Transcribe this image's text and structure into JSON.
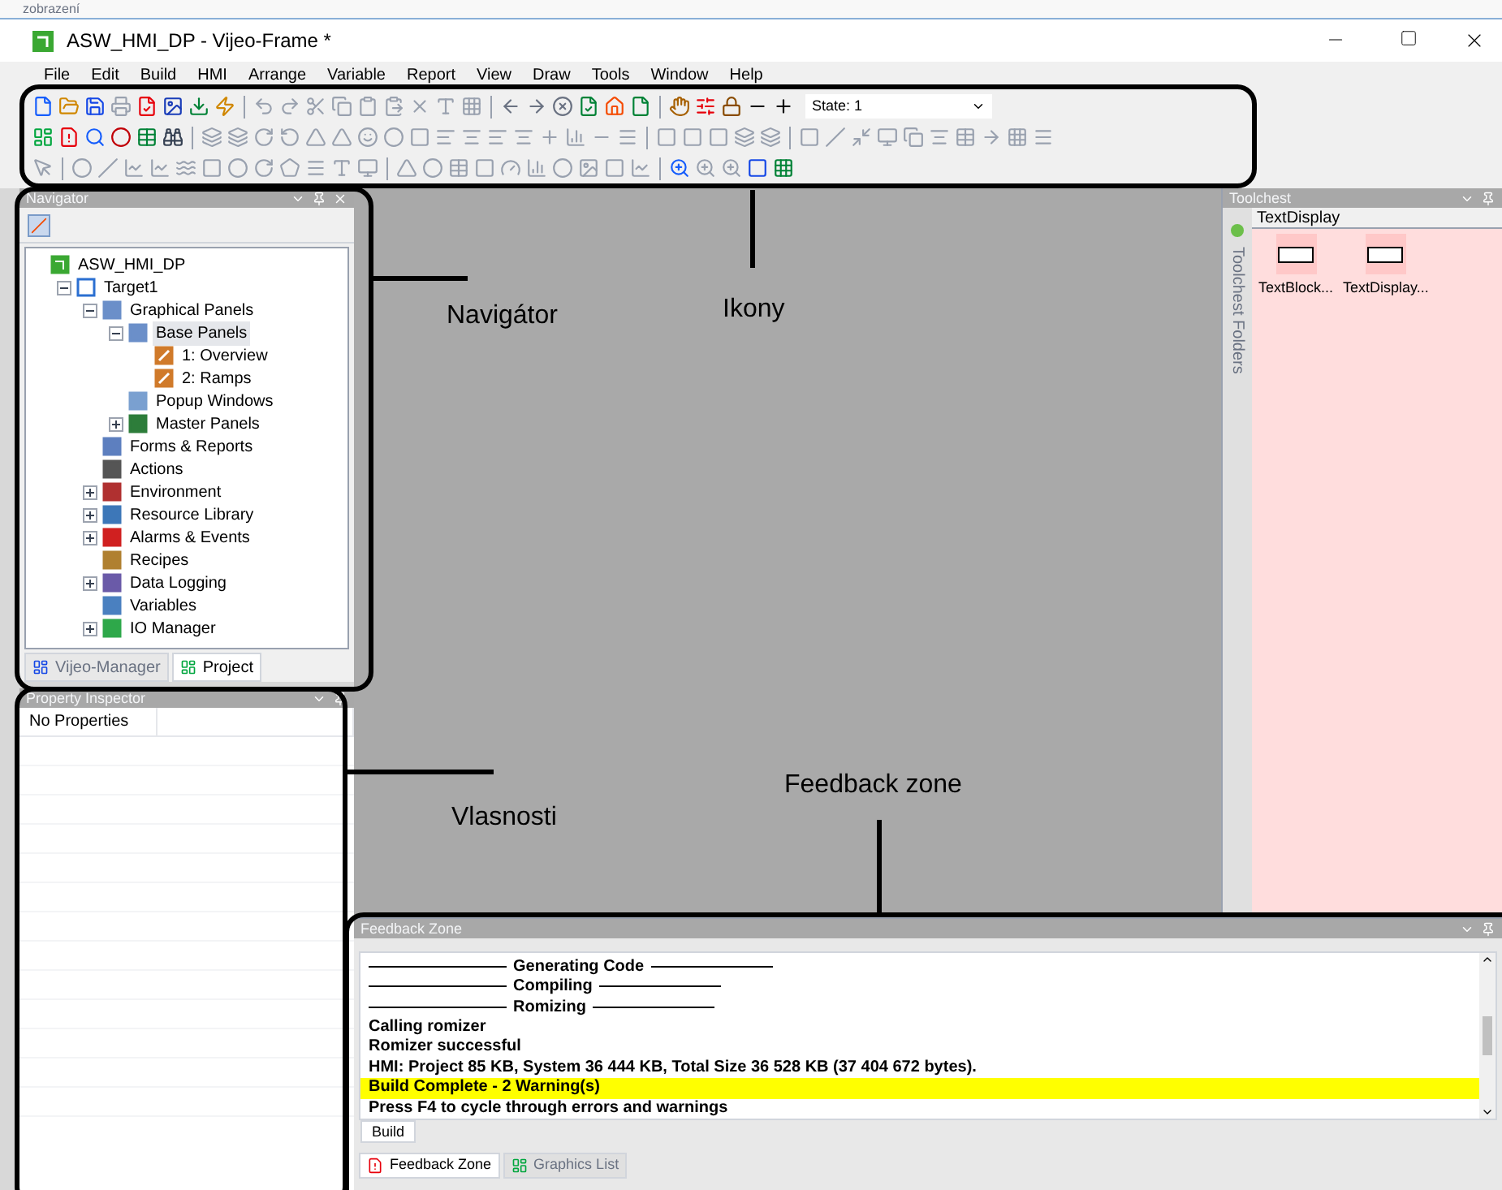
{
  "top_fragment": "zobrazení",
  "window": {
    "title": "ASW_HMI_DP - Vijeo-Frame *"
  },
  "menu": [
    "File",
    "Edit",
    "Build",
    "HMI",
    "Arrange",
    "Variable",
    "Report",
    "View",
    "Draw",
    "Tools",
    "Window",
    "Help"
  ],
  "toolbar": {
    "state_combo": {
      "value": "State: 1"
    }
  },
  "navigator": {
    "title": "Navigator",
    "tree": [
      {
        "label": "ASW_HMI_DP",
        "kind": "project",
        "selected": false,
        "children": [
          {
            "label": "Target1",
            "kind": "target",
            "expanded": true,
            "selected": false,
            "children": [
              {
                "label": "Graphical Panels",
                "kind": "panels",
                "expanded": true,
                "selected": false,
                "children": [
                  {
                    "label": "Base Panels",
                    "kind": "panels",
                    "expanded": true,
                    "selected": true,
                    "children": [
                      {
                        "label": "1: Overview",
                        "kind": "panel",
                        "selected": false
                      },
                      {
                        "label": "2: Ramps",
                        "kind": "panel",
                        "selected": false
                      }
                    ]
                  },
                  {
                    "label": "Popup Windows",
                    "kind": "popup",
                    "selected": false
                  },
                  {
                    "label": "Master Panels",
                    "kind": "master",
                    "expanded": false,
                    "selected": false
                  }
                ]
              },
              {
                "label": "Forms & Reports",
                "kind": "forms",
                "selected": false
              },
              {
                "label": "Actions",
                "kind": "actions",
                "selected": false
              },
              {
                "label": "Environment",
                "kind": "environment",
                "expanded": false,
                "selected": false
              },
              {
                "label": "Resource Library",
                "kind": "resources",
                "expanded": false,
                "selected": false
              },
              {
                "label": "Alarms & Events",
                "kind": "alarms",
                "expanded": false,
                "selected": false
              },
              {
                "label": "Recipes",
                "kind": "recipes",
                "selected": false
              },
              {
                "label": "Data Logging",
                "kind": "logging",
                "expanded": false,
                "selected": false
              },
              {
                "label": "Variables",
                "kind": "variables",
                "selected": false
              },
              {
                "label": "IO Manager",
                "kind": "io",
                "expanded": false,
                "selected": false
              }
            ]
          }
        ]
      }
    ],
    "tabs": [
      {
        "label": "Vijeo-Manager",
        "selected": false
      },
      {
        "label": "Project",
        "selected": true
      }
    ]
  },
  "property_inspector": {
    "title": "Property Inspector",
    "rows": [
      [
        "No Properties",
        ""
      ]
    ]
  },
  "toolchest": {
    "title": "Toolchest",
    "folders_tab": "Toolchest Folders",
    "combo": "TextDisplay",
    "items": [
      "TextBlock...",
      "TextDisplay..."
    ]
  },
  "feedback_zone": {
    "title": "Feedback Zone",
    "lines": [
      {
        "kind": "heading",
        "text": "Generating Code"
      },
      {
        "kind": "heading",
        "text": "Compiling"
      },
      {
        "kind": "heading",
        "text": "Romizing"
      },
      {
        "kind": "text",
        "text": "Calling romizer"
      },
      {
        "kind": "text",
        "text": "Romizer successful"
      },
      {
        "kind": "text",
        "text": "HMI: Project 85 KB, System 36 444 KB, Total Size 36 528 KB (37 404 672 bytes)."
      },
      {
        "kind": "highlight",
        "text": "Build Complete - 2 Warning(s)"
      },
      {
        "kind": "text",
        "text": "Press F4 to cycle through errors and warnings"
      }
    ],
    "inner_tabs": [
      {
        "label": "Build",
        "selected": true
      }
    ],
    "tabs": [
      {
        "label": "Feedback Zone",
        "selected": true
      },
      {
        "label": "Graphics List",
        "selected": false
      }
    ]
  },
  "annotations": [
    {
      "kind": "navigator",
      "text": "Navigátor"
    },
    {
      "kind": "icons",
      "text": "Ikony"
    },
    {
      "kind": "properties",
      "text": "Vlasnosti"
    },
    {
      "kind": "feedback",
      "text": "Feedback zone"
    }
  ]
}
